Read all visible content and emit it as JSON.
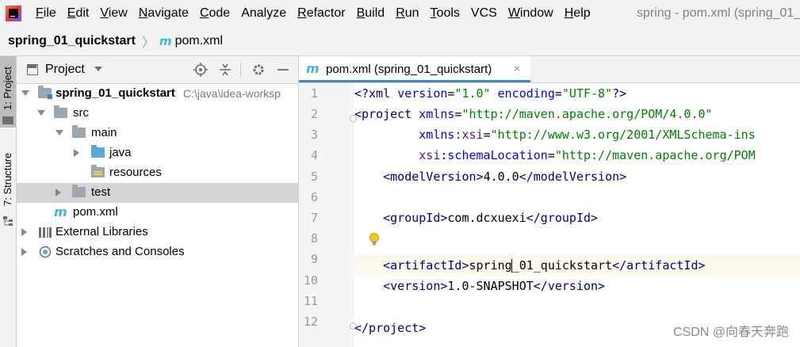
{
  "menu": {
    "items": [
      {
        "id": "file",
        "mnemonic": "F",
        "rest": "ile"
      },
      {
        "id": "edit",
        "mnemonic": "E",
        "rest": "dit"
      },
      {
        "id": "view",
        "mnemonic": "V",
        "rest": "iew"
      },
      {
        "id": "navigate",
        "mnemonic": "N",
        "rest": "avigate"
      },
      {
        "id": "code",
        "mnemonic": "C",
        "rest": "ode"
      },
      {
        "id": "analyze",
        "mnemonic": "",
        "rest": "Analyze"
      },
      {
        "id": "refactor",
        "mnemonic": "R",
        "rest": "efactor"
      },
      {
        "id": "build",
        "mnemonic": "B",
        "rest": "uild"
      },
      {
        "id": "run",
        "mnemonic": "R",
        "rest": "un"
      },
      {
        "id": "tools",
        "mnemonic": "T",
        "rest": "ools"
      },
      {
        "id": "vcs",
        "mnemonic": "",
        "rest": "VCS"
      },
      {
        "id": "window",
        "mnemonic": "W",
        "rest": "indow"
      },
      {
        "id": "help",
        "mnemonic": "H",
        "rest": "elp"
      }
    ]
  },
  "window_title": "spring - pom.xml (spring_01_",
  "breadcrumb": {
    "project": "spring_01_quickstart",
    "separator": "〉",
    "file_icon": "m",
    "file": "pom.xml"
  },
  "toolwindows": {
    "project_tab": "1: Project",
    "structure_tab": "7: Structure"
  },
  "project_panel": {
    "title": "Project",
    "tree": [
      {
        "label": "spring_01_quickstart",
        "path": "C:\\java\\idea-worksp",
        "bold": true
      },
      {
        "label": "src"
      },
      {
        "label": "main"
      },
      {
        "label": "java"
      },
      {
        "label": "resources"
      },
      {
        "label": "test"
      },
      {
        "label": "pom.xml",
        "icon_text": "m"
      },
      {
        "label": "External Libraries"
      },
      {
        "label": "Scratches and Consoles"
      }
    ]
  },
  "editor": {
    "tab_icon": "m",
    "tab_label": "pom.xml (spring_01_quickstart)",
    "tab_close": "×",
    "line_numbers": [
      "1",
      "2",
      "3",
      "4",
      "5",
      "6",
      "7",
      "8",
      "9",
      "10",
      "11",
      "12"
    ],
    "code": {
      "l1_a": "<?xml ",
      "l1_b": "version",
      "l1_c": "=",
      "l1_d": "\"1.0\"",
      "l1_e": " ",
      "l1_f": "encoding",
      "l1_g": "=",
      "l1_h": "\"UTF-8\"",
      "l1_i": "?>",
      "l2_a": "<project ",
      "l2_b": "xmlns",
      "l2_c": "=",
      "l2_d": "\"http://maven.apache.org/POM/4.0.0\"",
      "l3_a": "         ",
      "l3_b": "xmlns",
      "l3_c": ":xsi",
      "l3_d": "=",
      "l3_e": "\"http://www.w3.org/2001/XMLSchema-ins",
      "l4_a": "         ",
      "l4_b": "xsi",
      "l4_c": ":schemaLocation",
      "l4_d": "=",
      "l4_e": "\"http://maven.apache.org/POM",
      "l5_a": "    <modelVersion>",
      "l5_b": "4.0.0",
      "l5_c": "</modelVersion>",
      "l7_a": "    <groupId>",
      "l7_b": "com.dcxuexi",
      "l7_c": "</groupId>",
      "l8_a": "    <artifactId>",
      "l8_b1": "spring",
      "l8_b2": "_01_quickstart",
      "l8_c": "</artifactId>",
      "l9_a": "    <version>",
      "l9_b": "1.0-SNAPSHOT",
      "l9_c": "</version>",
      "l12_a": "</project>"
    }
  },
  "watermark": "CSDN @向春天奔跑",
  "colors": {
    "tag": "#000080",
    "attr": "#0000ff",
    "namespace": "#660e7a",
    "value": "#008000",
    "tab_underline": "#4083c9",
    "maven_icon": "#40b6e0"
  }
}
